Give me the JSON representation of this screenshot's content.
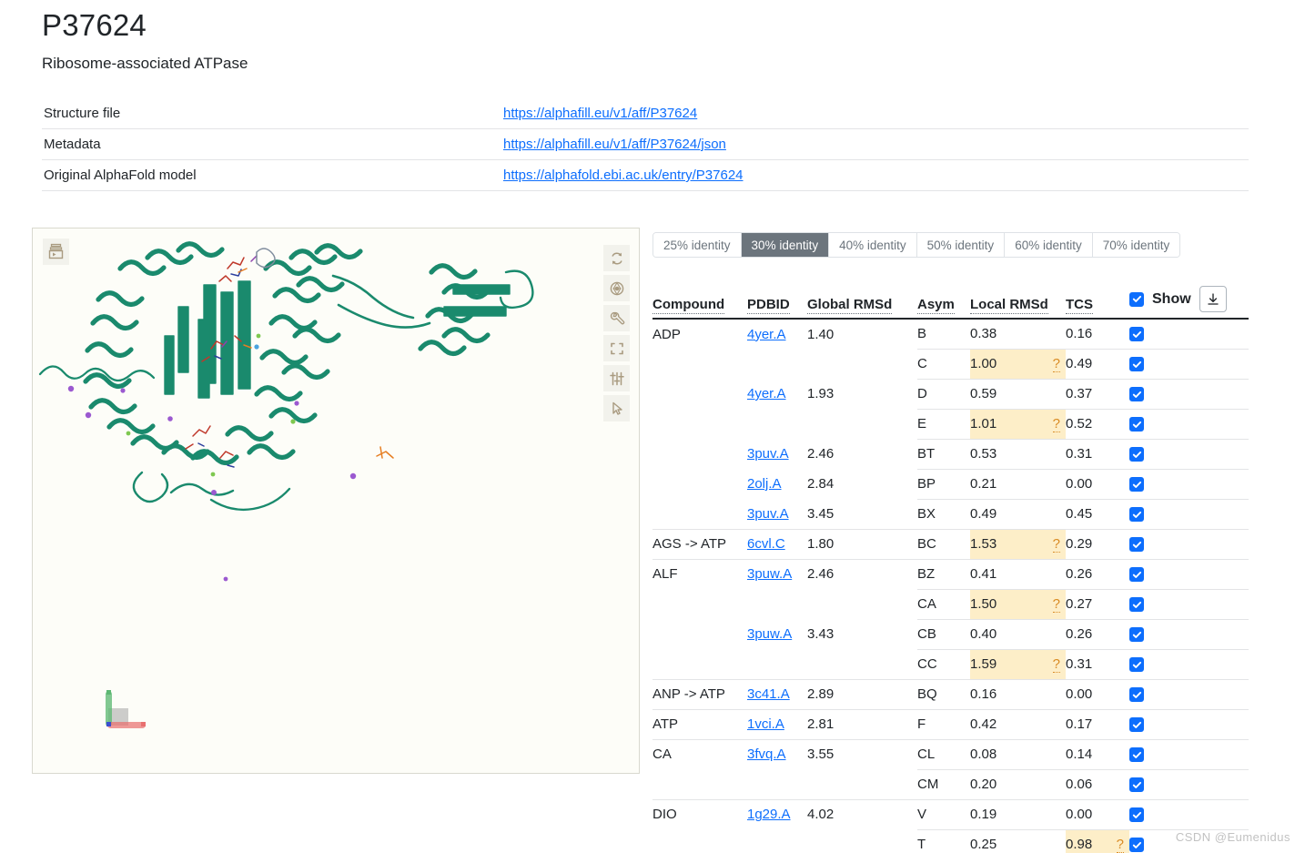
{
  "header": {
    "title": "P37624",
    "subtitle": "Ribosome-associated ATPase"
  },
  "info_table": {
    "rows": [
      {
        "label": "Structure file",
        "link": "https://alphafill.eu/v1/aff/P37624"
      },
      {
        "label": "Metadata",
        "link": "https://alphafill.eu/v1/aff/P37624/json"
      },
      {
        "label": "Original AlphaFold model",
        "link": "https://alphafold.ebi.ac.uk/entry/P37624"
      }
    ]
  },
  "viewer": {
    "panel_button_icon": "layers-panel-icon",
    "toolbar": [
      {
        "icon": "reset-rotation-icon",
        "name": "reset-view-button"
      },
      {
        "icon": "screenshot-icon",
        "name": "screenshot-button"
      },
      {
        "icon": "wrench-icon",
        "name": "settings-button"
      },
      {
        "icon": "fullscreen-icon",
        "name": "fullscreen-button"
      },
      {
        "icon": "sliders-icon",
        "name": "controls-button"
      },
      {
        "icon": "cursor-icon",
        "name": "select-mode-button"
      }
    ],
    "axes": {
      "x_color": "#e87070",
      "y_color": "#5db873",
      "z_color": "#b9b9b9",
      "origin_color": "#3b4fd0"
    },
    "structure_color": "#1a8a6d",
    "background_color": "#fdfdf8"
  },
  "tabs": {
    "items": [
      {
        "label": "25% identity",
        "active": false
      },
      {
        "label": "30% identity",
        "active": true
      },
      {
        "label": "40% identity",
        "active": false
      },
      {
        "label": "50% identity",
        "active": false
      },
      {
        "label": "60% identity",
        "active": false
      },
      {
        "label": "70% identity",
        "active": false
      }
    ]
  },
  "table": {
    "headers": {
      "compound": "Compound",
      "pdbid": "PDBID",
      "global_rmsd": "Global RMSd",
      "asym": "Asym",
      "local_rmsd": "Local RMSd",
      "tcs": "TCS",
      "show": "Show"
    },
    "download_icon": "download-icon",
    "header_checked": true,
    "rows": [
      {
        "compound": "ADP",
        "pdbid": "4yer.A",
        "global_rmsd": "1.40",
        "asym": "B",
        "local_rmsd": "0.38",
        "local_hl": false,
        "tcs": "0.16",
        "tcs_hl": false,
        "checked": true,
        "group_start": true
      },
      {
        "compound": "",
        "pdbid": "",
        "global_rmsd": "",
        "asym": "C",
        "local_rmsd": "1.00",
        "local_hl": true,
        "tcs": "0.49",
        "tcs_hl": false,
        "checked": true,
        "group_start": false
      },
      {
        "compound": "",
        "pdbid": "4yer.A",
        "global_rmsd": "1.93",
        "asym": "D",
        "local_rmsd": "0.59",
        "local_hl": false,
        "tcs": "0.37",
        "tcs_hl": false,
        "checked": true,
        "group_start": false
      },
      {
        "compound": "",
        "pdbid": "",
        "global_rmsd": "",
        "asym": "E",
        "local_rmsd": "1.01",
        "local_hl": true,
        "tcs": "0.52",
        "tcs_hl": false,
        "checked": true,
        "group_start": false
      },
      {
        "compound": "",
        "pdbid": "3puv.A",
        "global_rmsd": "2.46",
        "asym": "BT",
        "local_rmsd": "0.53",
        "local_hl": false,
        "tcs": "0.31",
        "tcs_hl": false,
        "checked": true,
        "group_start": false
      },
      {
        "compound": "",
        "pdbid": "2olj.A",
        "global_rmsd": "2.84",
        "asym": "BP",
        "local_rmsd": "0.21",
        "local_hl": false,
        "tcs": "0.00",
        "tcs_hl": false,
        "checked": true,
        "group_start": false
      },
      {
        "compound": "",
        "pdbid": "3puv.A",
        "global_rmsd": "3.45",
        "asym": "BX",
        "local_rmsd": "0.49",
        "local_hl": false,
        "tcs": "0.45",
        "tcs_hl": false,
        "checked": true,
        "group_start": false
      },
      {
        "compound": "AGS -> ATP",
        "pdbid": "6cvl.C",
        "global_rmsd": "1.80",
        "asym": "BC",
        "local_rmsd": "1.53",
        "local_hl": true,
        "tcs": "0.29",
        "tcs_hl": false,
        "checked": true,
        "group_start": true
      },
      {
        "compound": "ALF",
        "pdbid": "3puw.A",
        "global_rmsd": "2.46",
        "asym": "BZ",
        "local_rmsd": "0.41",
        "local_hl": false,
        "tcs": "0.26",
        "tcs_hl": false,
        "checked": true,
        "group_start": true
      },
      {
        "compound": "",
        "pdbid": "",
        "global_rmsd": "",
        "asym": "CA",
        "local_rmsd": "1.50",
        "local_hl": true,
        "tcs": "0.27",
        "tcs_hl": false,
        "checked": true,
        "group_start": false
      },
      {
        "compound": "",
        "pdbid": "3puw.A",
        "global_rmsd": "3.43",
        "asym": "CB",
        "local_rmsd": "0.40",
        "local_hl": false,
        "tcs": "0.26",
        "tcs_hl": false,
        "checked": true,
        "group_start": false
      },
      {
        "compound": "",
        "pdbid": "",
        "global_rmsd": "",
        "asym": "CC",
        "local_rmsd": "1.59",
        "local_hl": true,
        "tcs": "0.31",
        "tcs_hl": false,
        "checked": true,
        "group_start": false
      },
      {
        "compound": "ANP -> ATP",
        "pdbid": "3c41.A",
        "global_rmsd": "2.89",
        "asym": "BQ",
        "local_rmsd": "0.16",
        "local_hl": false,
        "tcs": "0.00",
        "tcs_hl": false,
        "checked": true,
        "group_start": true
      },
      {
        "compound": "ATP",
        "pdbid": "1vci.A",
        "global_rmsd": "2.81",
        "asym": "F",
        "local_rmsd": "0.42",
        "local_hl": false,
        "tcs": "0.17",
        "tcs_hl": false,
        "checked": true,
        "group_start": true
      },
      {
        "compound": "CA",
        "pdbid": "3fvq.A",
        "global_rmsd": "3.55",
        "asym": "CL",
        "local_rmsd": "0.08",
        "local_hl": false,
        "tcs": "0.14",
        "tcs_hl": false,
        "checked": true,
        "group_start": true
      },
      {
        "compound": "",
        "pdbid": "",
        "global_rmsd": "",
        "asym": "CM",
        "local_rmsd": "0.20",
        "local_hl": false,
        "tcs": "0.06",
        "tcs_hl": false,
        "checked": true,
        "group_start": false
      },
      {
        "compound": "DIO",
        "pdbid": "1g29.A",
        "global_rmsd": "4.02",
        "asym": "V",
        "local_rmsd": "0.19",
        "local_hl": false,
        "tcs": "0.00",
        "tcs_hl": false,
        "checked": true,
        "group_start": true
      },
      {
        "compound": "",
        "pdbid": "",
        "global_rmsd": "",
        "asym": "T",
        "local_rmsd": "0.25",
        "local_hl": false,
        "tcs": "0.98",
        "tcs_hl": true,
        "checked": true,
        "group_start": false
      }
    ],
    "question_mark": "?"
  },
  "watermark": "CSDN @Eumenidus",
  "colors": {
    "link": "#0d6efd",
    "checkbox": "#0d6efd",
    "active_tab_bg": "#6c757d",
    "highlight_bg": "#fdeec8",
    "question_mark": "#d98b24"
  }
}
